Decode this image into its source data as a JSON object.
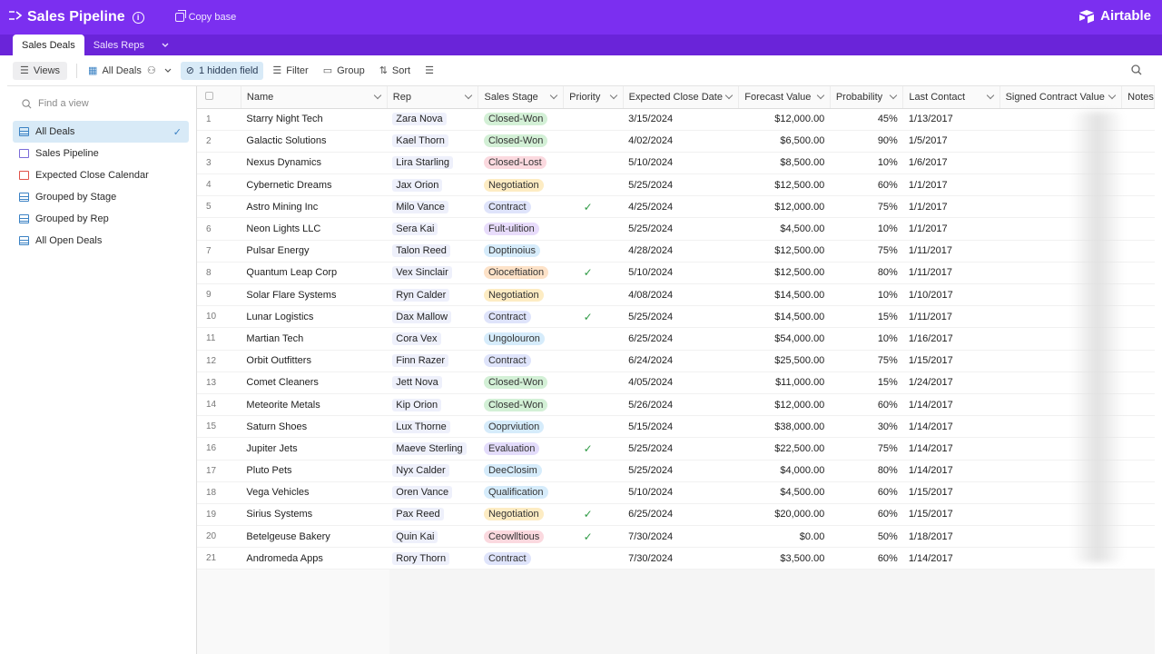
{
  "app": {
    "title": "Sales Pipeline",
    "copy_base": "Copy base",
    "brand": "Airtable"
  },
  "tabs": [
    {
      "label": "Sales Deals"
    },
    {
      "label": "Sales Reps"
    }
  ],
  "toolbar": {
    "views": "Views",
    "view_name": "All Deals",
    "hidden_field": "1 hidden field",
    "filter": "Filter",
    "group": "Group",
    "sort": "Sort"
  },
  "sidebar": {
    "find_placeholder": "Find a view",
    "items": [
      {
        "label": "All Deals"
      },
      {
        "label": "Sales Pipeline"
      },
      {
        "label": "Expected Close Calendar"
      },
      {
        "label": "Grouped by Stage"
      },
      {
        "label": "Grouped by Rep"
      },
      {
        "label": "All Open Deals"
      }
    ]
  },
  "columns": [
    "Name",
    "Rep",
    "Sales Stage",
    "Priority",
    "Expected Close Date",
    "Forecast Value",
    "Probability",
    "Last Contact",
    "Signed Contract Value",
    "Notes"
  ],
  "stage_colors": {
    "Closed-Won": "#d3f0d6",
    "Closed-Lost": "#fbd9df",
    "Negotiation": "#fdecc3",
    "Contract": "#dfe4fb",
    "Fult-ulition": "#e8dcfb",
    "Doptinoius": "#d6ecfb",
    "Oioceftiation": "#fde2c8",
    "Ungolouron": "#d6ecfb",
    "Ooprviution": "#d6ecfb",
    "Evaluation": "#e3dcfb",
    "DeeClosim": "#d6ecfb",
    "Qualification": "#d6ecfb",
    "Ceowlltious": "#fbd9df"
  },
  "rows": [
    {
      "n": "1",
      "name": "Starry Night Tech",
      "rep": "Zara Nova",
      "stage": "Closed-Won",
      "priority": "",
      "close": "3/15/2024",
      "forecast": "$12,000.00",
      "prob": "45%",
      "last": "1/13/2017"
    },
    {
      "n": "2",
      "name": "Galactic Solutions",
      "rep": "Kael Thorn",
      "stage": "Closed-Won",
      "priority": "",
      "close": "4/02/2024",
      "forecast": "$6,500.00",
      "prob": "90%",
      "last": "1/5/2017"
    },
    {
      "n": "3",
      "name": "Nexus Dynamics",
      "rep": "Lira Starling",
      "stage": "Closed-Lost",
      "priority": "",
      "close": "5/10/2024",
      "forecast": "$8,500.00",
      "prob": "10%",
      "last": "1/6/2017"
    },
    {
      "n": "4",
      "name": "Cybernetic Dreams",
      "rep": "Jax Orion",
      "stage": "Negotiation",
      "priority": "",
      "close": "5/25/2024",
      "forecast": "$12,500.00",
      "prob": "60%",
      "last": "1/1/2017"
    },
    {
      "n": "5",
      "name": "Astro Mining Inc",
      "rep": "Milo Vance",
      "stage": "Contract",
      "priority": "✓",
      "close": "4/25/2024",
      "forecast": "$12,000.00",
      "prob": "75%",
      "last": "1/1/2017"
    },
    {
      "n": "6",
      "name": "Neon Lights LLC",
      "rep": "Sera Kai",
      "stage": "Fult-ulition",
      "priority": "",
      "close": "5/25/2024",
      "forecast": "$4,500.00",
      "prob": "10%",
      "last": "1/1/2017"
    },
    {
      "n": "7",
      "name": "Pulsar Energy",
      "rep": "Talon Reed",
      "stage": "Doptinoius",
      "priority": "",
      "close": "4/28/2024",
      "forecast": "$12,500.00",
      "prob": "75%",
      "last": "1/11/2017"
    },
    {
      "n": "8",
      "name": "Quantum Leap Corp",
      "rep": "Vex Sinclair",
      "stage": "Oioceftiation",
      "priority": "✓",
      "close": "5/10/2024",
      "forecast": "$12,500.00",
      "prob": "80%",
      "last": "1/11/2017"
    },
    {
      "n": "9",
      "name": "Solar Flare Systems",
      "rep": "Ryn Calder",
      "stage": "Negotiation",
      "priority": "",
      "close": "4/08/2024",
      "forecast": "$14,500.00",
      "prob": "10%",
      "last": "1/10/2017"
    },
    {
      "n": "10",
      "name": "Lunar Logistics",
      "rep": "Dax Mallow",
      "stage": "Contract",
      "priority": "✓",
      "close": "5/25/2024",
      "forecast": "$14,500.00",
      "prob": "15%",
      "last": "1/11/2017"
    },
    {
      "n": "11",
      "name": "Martian Tech",
      "rep": "Cora Vex",
      "stage": "Ungolouron",
      "priority": "",
      "close": "6/25/2024",
      "forecast": "$54,000.00",
      "prob": "10%",
      "last": "1/16/2017"
    },
    {
      "n": "12",
      "name": "Orbit Outfitters",
      "rep": "Finn Razer",
      "stage": "Contract",
      "priority": "",
      "close": "6/24/2024",
      "forecast": "$25,500.00",
      "prob": "75%",
      "last": "1/15/2017"
    },
    {
      "n": "13",
      "name": "Comet Cleaners",
      "rep": "Jett Nova",
      "stage": "Closed-Won",
      "priority": "",
      "close": "4/05/2024",
      "forecast": "$11,000.00",
      "prob": "15%",
      "last": "1/24/2017"
    },
    {
      "n": "14",
      "name": "Meteorite Metals",
      "rep": "Kip Orion",
      "stage": "Closed-Won",
      "priority": "",
      "close": "5/26/2024",
      "forecast": "$12,000.00",
      "prob": "60%",
      "last": "1/14/2017"
    },
    {
      "n": "15",
      "name": "Saturn Shoes",
      "rep": "Lux Thorne",
      "stage": "Ooprviution",
      "priority": "",
      "close": "5/15/2024",
      "forecast": "$38,000.00",
      "prob": "30%",
      "last": "1/14/2017"
    },
    {
      "n": "16",
      "name": "Jupiter Jets",
      "rep": "Maeve Sterling",
      "stage": "Evaluation",
      "priority": "✓",
      "close": "5/25/2024",
      "forecast": "$22,500.00",
      "prob": "75%",
      "last": "1/14/2017"
    },
    {
      "n": "17",
      "name": "Pluto Pets",
      "rep": "Nyx Calder",
      "stage": "DeeClosim",
      "priority": "",
      "close": "5/25/2024",
      "forecast": "$4,000.00",
      "prob": "80%",
      "last": "1/14/2017"
    },
    {
      "n": "18",
      "name": "Vega Vehicles",
      "rep": "Oren Vance",
      "stage": "Qualification",
      "priority": "",
      "close": "5/10/2024",
      "forecast": "$4,500.00",
      "prob": "60%",
      "last": "1/15/2017"
    },
    {
      "n": "19",
      "name": "Sirius Systems",
      "rep": "Pax Reed",
      "stage": "Negotiation",
      "priority": "✓",
      "close": "6/25/2024",
      "forecast": "$20,000.00",
      "prob": "60%",
      "last": "1/15/2017"
    },
    {
      "n": "20",
      "name": "Betelgeuse Bakery",
      "rep": "Quin Kai",
      "stage": "Ceowlltious",
      "priority": "✓",
      "close": "7/30/2024",
      "forecast": "$0.00",
      "prob": "50%",
      "last": "1/18/2017"
    },
    {
      "n": "21",
      "name": "Andromeda Apps",
      "rep": "Rory Thorn",
      "stage": "Contract",
      "priority": "",
      "close": "7/30/2024",
      "forecast": "$3,500.00",
      "prob": "60%",
      "last": "1/14/2017"
    }
  ]
}
